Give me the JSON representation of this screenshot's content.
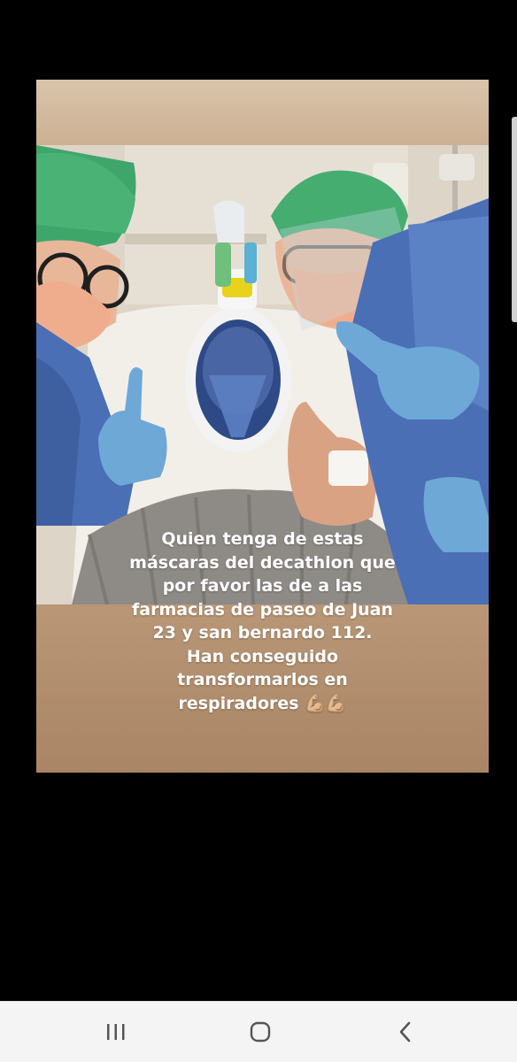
{
  "story": {
    "caption_lines": [
      "Quien tenga de estas",
      "máscaras del decathlon que",
      "por favor las de a las",
      "farmacias de paseo de Juan",
      "23 y san bernardo 112.",
      "Han conseguido",
      "transformarlos en",
      "respiradores 💪🏼💪🏼"
    ],
    "photo_icon": "photo-hospital-selfie"
  },
  "nav_bar": {
    "recent_icon": "recent-apps-icon",
    "home_icon": "home-icon",
    "back_icon": "back-icon"
  },
  "colors": {
    "background": "#000000",
    "card": "#c2a283",
    "surgical_cap": "#3fa66b",
    "gown": "#4a6fb5",
    "glove": "#6ea8d6",
    "nav_bar": "#f4f4f4"
  }
}
